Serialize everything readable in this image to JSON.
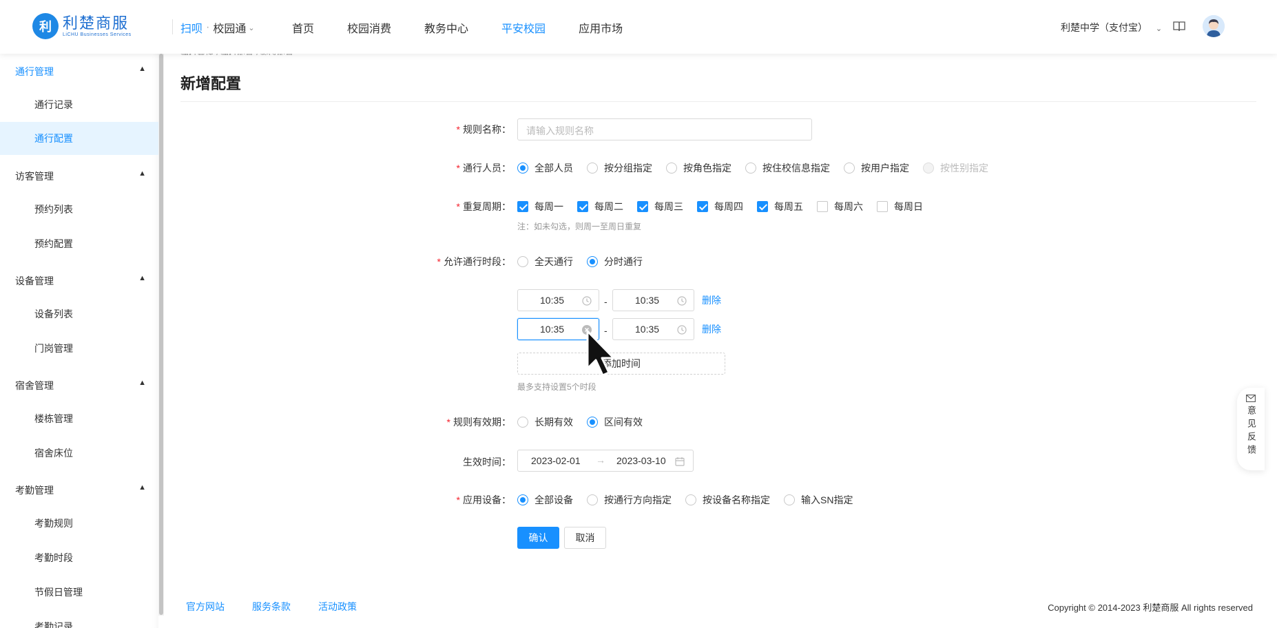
{
  "header": {
    "logo_mark": "利",
    "logo_cn": "利楚商服",
    "logo_en": "LiCHU Businesses Services",
    "scan": "扫呗",
    "dot": "·",
    "app_name": "校园通",
    "nav": [
      {
        "label": "首页",
        "active": false
      },
      {
        "label": "校园消费",
        "active": false
      },
      {
        "label": "教务中心",
        "active": false
      },
      {
        "label": "平安校园",
        "active": true
      },
      {
        "label": "应用市场",
        "active": false
      }
    ],
    "school": "利楚中学（支付宝）"
  },
  "sidebar": {
    "groups": [
      {
        "label": "通行管理",
        "active": true,
        "items": [
          {
            "label": "通行记录",
            "active": false
          },
          {
            "label": "通行配置",
            "active": true
          }
        ]
      },
      {
        "label": "访客管理",
        "active": false,
        "items": [
          {
            "label": "预约列表",
            "active": false
          },
          {
            "label": "预约配置",
            "active": false
          }
        ]
      },
      {
        "label": "设备管理",
        "active": false,
        "items": [
          {
            "label": "设备列表",
            "active": false
          },
          {
            "label": "门岗管理",
            "active": false
          }
        ]
      },
      {
        "label": "宿舍管理",
        "active": false,
        "items": [
          {
            "label": "楼栋管理",
            "active": false
          },
          {
            "label": "宿舍床位",
            "active": false
          }
        ]
      },
      {
        "label": "考勤管理",
        "active": false,
        "items": [
          {
            "label": "考勤规则",
            "active": false
          },
          {
            "label": "考勤时段",
            "active": false
          },
          {
            "label": "节假日管理",
            "active": false
          },
          {
            "label": "考勤记录",
            "active": false
          }
        ]
      }
    ]
  },
  "breadcrumb": "通行管理  /  通行配置  /  修改配置",
  "page_title": "新增配置",
  "form": {
    "rule_name": {
      "label": "规则名称",
      "placeholder": "请输入规则名称",
      "value": ""
    },
    "people": {
      "label": "通行人员",
      "options": [
        {
          "label": "全部人员",
          "checked": true,
          "disabled": false
        },
        {
          "label": "按分组指定",
          "checked": false,
          "disabled": false
        },
        {
          "label": "按角色指定",
          "checked": false,
          "disabled": false
        },
        {
          "label": "按住校信息指定",
          "checked": false,
          "disabled": false
        },
        {
          "label": "按用户指定",
          "checked": false,
          "disabled": false
        },
        {
          "label": "按性别指定",
          "checked": false,
          "disabled": true
        }
      ]
    },
    "repeat": {
      "label": "重复周期",
      "options": [
        {
          "label": "每周一",
          "checked": true
        },
        {
          "label": "每周二",
          "checked": true
        },
        {
          "label": "每周三",
          "checked": true
        },
        {
          "label": "每周四",
          "checked": true
        },
        {
          "label": "每周五",
          "checked": true
        },
        {
          "label": "每周六",
          "checked": false
        },
        {
          "label": "每周日",
          "checked": false
        }
      ],
      "note": "注：如未勾选，则周一至周日重复"
    },
    "period": {
      "label": "允许通行时段",
      "options": [
        {
          "label": "全天通行",
          "checked": false
        },
        {
          "label": "分时通行",
          "checked": true
        }
      ]
    },
    "time_slots": [
      {
        "start": "10:35",
        "end": "10:35",
        "delete": "删除"
      },
      {
        "start": "10:35",
        "end": "10:35",
        "delete": "删除"
      }
    ],
    "range_dash": "-",
    "add_time": "添加时间",
    "slot_note": "最多支持设置5个时段",
    "validity": {
      "label": "规则有效期",
      "options": [
        {
          "label": "长期有效",
          "checked": false
        },
        {
          "label": "区间有效",
          "checked": true
        }
      ]
    },
    "effective": {
      "label": "生效时间",
      "start": "2023-02-01",
      "arrow": "→",
      "end": "2023-03-10"
    },
    "devices": {
      "label": "应用设备",
      "options": [
        {
          "label": "全部设备",
          "checked": true
        },
        {
          "label": "按通行方向指定",
          "checked": false
        },
        {
          "label": "按设备名称指定",
          "checked": false
        },
        {
          "label": "输入SN指定",
          "checked": false
        }
      ]
    },
    "confirm": "确认",
    "cancel": "取消"
  },
  "footer": {
    "links": [
      "官方网站",
      "服务条款",
      "活动政策"
    ],
    "copyright": "Copyright © 2014-2023 利楚商服 All rights reserved"
  },
  "feedback": "意见反馈",
  "colors": {
    "primary": "#1890ff",
    "required": "#f5222d"
  }
}
